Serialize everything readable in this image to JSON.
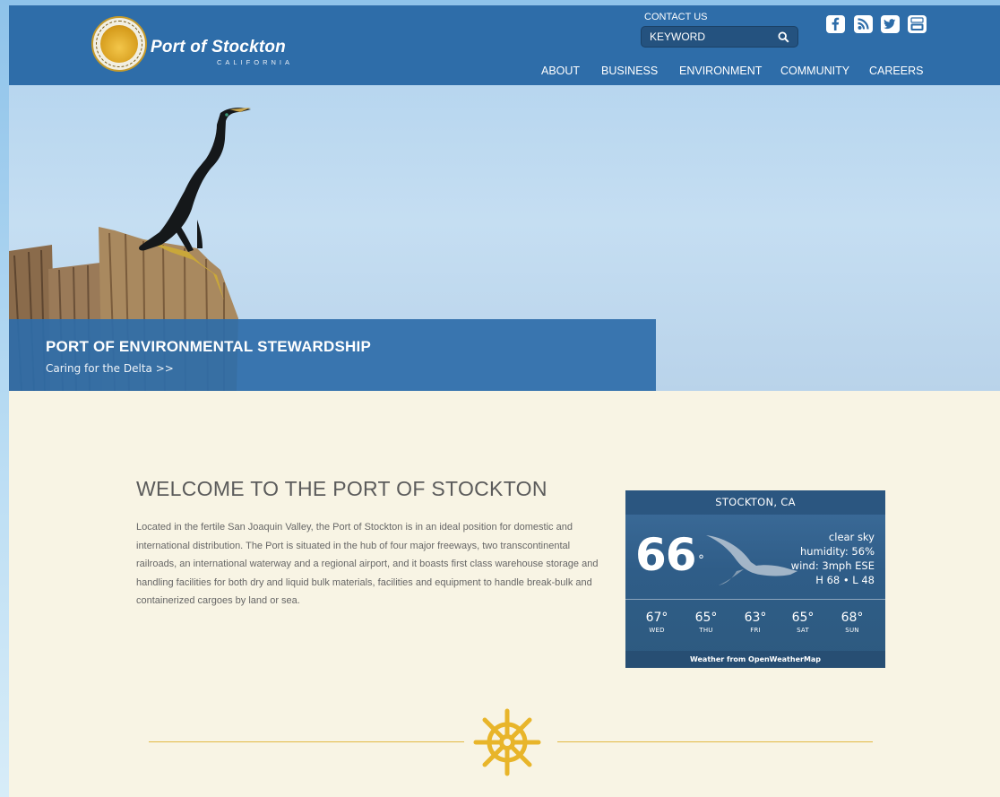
{
  "header": {
    "logo": {
      "name": "Port of Stockton",
      "subtitle": "CALIFORNIA",
      "seal_text": "PORT OF STOCKTON · CALIFORNIA"
    },
    "contact_label": "CONTACT US",
    "search": {
      "placeholder": "KEYWORD",
      "value": ""
    },
    "social": [
      "facebook-icon",
      "rss-icon",
      "twitter-icon",
      "youtube-icon"
    ],
    "nav": [
      "ABOUT",
      "BUSINESS",
      "ENVIRONMENT",
      "COMMUNITY",
      "CAREERS"
    ]
  },
  "hero": {
    "title": "PORT OF ENVIRONMENTAL STEWARDSHIP",
    "link": "Caring for the Delta >>"
  },
  "welcome": {
    "title": "WELCOME TO THE PORT OF STOCKTON",
    "body": "Located in the fertile San Joaquin Valley, the Port of Stockton is in an ideal position for domestic and international distribution. The Port is situated in the hub of four major freeways, two transcontinental railroads, an international waterway and a regional airport, and it boasts first class warehouse storage and handling facilities for both dry and liquid bulk materials, facilities and equipment to handle break-bulk and containerized cargoes by land or sea."
  },
  "weather": {
    "city": "STOCKTON, CA",
    "temp": "66",
    "degree": "°",
    "condition": "clear sky",
    "humidity": "humidity: 56%",
    "wind": "wind: 3mph ESE",
    "hilo": "H 68 • L 48",
    "forecast": [
      {
        "temp": "67°",
        "day": "WED"
      },
      {
        "temp": "65°",
        "day": "THU"
      },
      {
        "temp": "63°",
        "day": "FRI"
      },
      {
        "temp": "65°",
        "day": "SAT"
      },
      {
        "temp": "68°",
        "day": "SUN"
      }
    ],
    "credit": "Weather from OpenWeatherMap"
  },
  "colors": {
    "header_blue": "#2e6da9",
    "content_cream": "#f8f4e4",
    "accent_gold": "#e2b944",
    "weather_blue": "#2f5d88"
  }
}
